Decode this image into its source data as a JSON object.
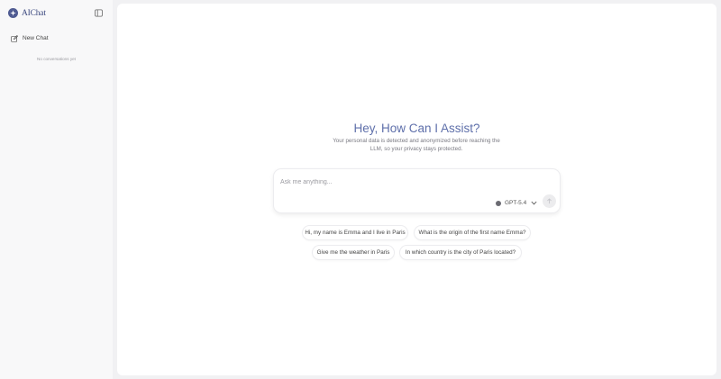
{
  "sidebar": {
    "brand_name": "AIChat",
    "new_chat_label": "New Chat",
    "empty_text": "No conversations yet"
  },
  "hero": {
    "title": "Hey, How Can I Assist?",
    "subtitle": "Your personal data is detected and anonymized before reaching the LLM, so your privacy stays protected."
  },
  "composer": {
    "placeholder": "Ask me anything...",
    "model_label": "GPT-5.4"
  },
  "suggestions": [
    "Hi, my name is Emma and I live in Paris",
    "What is the origin of the first name Emma?",
    "Give me the weather in Paris",
    "In which country is the city of Paris located?"
  ],
  "colors": {
    "accent": "#5e6faa",
    "brand": "#3d4a80",
    "page_background": "#f1f1f3",
    "sidebar_background": "#f8f8f9"
  },
  "icons": {
    "logo": "sparkle-logo-icon",
    "toggle": "sidebar-toggle-icon",
    "new_chat": "edit-icon",
    "model": "circle-dot-icon",
    "chevron": "chevron-down-icon",
    "send": "arrow-up-icon"
  }
}
